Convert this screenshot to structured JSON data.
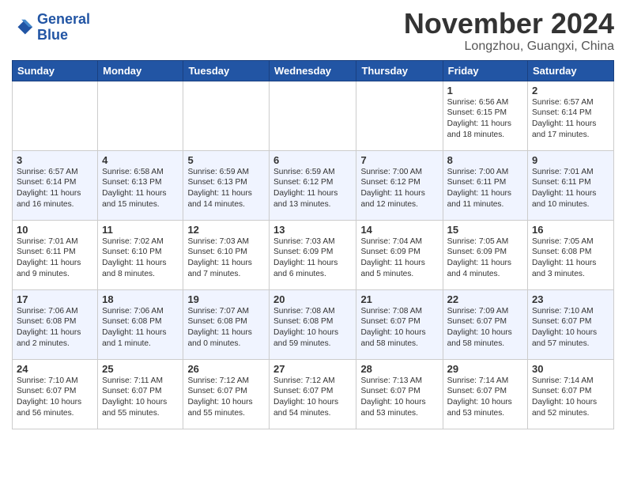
{
  "header": {
    "logo_line1": "General",
    "logo_line2": "Blue",
    "month_title": "November 2024",
    "location": "Longzhou, Guangxi, China"
  },
  "days_of_week": [
    "Sunday",
    "Monday",
    "Tuesday",
    "Wednesday",
    "Thursday",
    "Friday",
    "Saturday"
  ],
  "weeks": [
    [
      {
        "day": "",
        "info": ""
      },
      {
        "day": "",
        "info": ""
      },
      {
        "day": "",
        "info": ""
      },
      {
        "day": "",
        "info": ""
      },
      {
        "day": "",
        "info": ""
      },
      {
        "day": "1",
        "info": "Sunrise: 6:56 AM\nSunset: 6:15 PM\nDaylight: 11 hours and 18 minutes."
      },
      {
        "day": "2",
        "info": "Sunrise: 6:57 AM\nSunset: 6:14 PM\nDaylight: 11 hours and 17 minutes."
      }
    ],
    [
      {
        "day": "3",
        "info": "Sunrise: 6:57 AM\nSunset: 6:14 PM\nDaylight: 11 hours and 16 minutes."
      },
      {
        "day": "4",
        "info": "Sunrise: 6:58 AM\nSunset: 6:13 PM\nDaylight: 11 hours and 15 minutes."
      },
      {
        "day": "5",
        "info": "Sunrise: 6:59 AM\nSunset: 6:13 PM\nDaylight: 11 hours and 14 minutes."
      },
      {
        "day": "6",
        "info": "Sunrise: 6:59 AM\nSunset: 6:12 PM\nDaylight: 11 hours and 13 minutes."
      },
      {
        "day": "7",
        "info": "Sunrise: 7:00 AM\nSunset: 6:12 PM\nDaylight: 11 hours and 12 minutes."
      },
      {
        "day": "8",
        "info": "Sunrise: 7:00 AM\nSunset: 6:11 PM\nDaylight: 11 hours and 11 minutes."
      },
      {
        "day": "9",
        "info": "Sunrise: 7:01 AM\nSunset: 6:11 PM\nDaylight: 11 hours and 10 minutes."
      }
    ],
    [
      {
        "day": "10",
        "info": "Sunrise: 7:01 AM\nSunset: 6:11 PM\nDaylight: 11 hours and 9 minutes."
      },
      {
        "day": "11",
        "info": "Sunrise: 7:02 AM\nSunset: 6:10 PM\nDaylight: 11 hours and 8 minutes."
      },
      {
        "day": "12",
        "info": "Sunrise: 7:03 AM\nSunset: 6:10 PM\nDaylight: 11 hours and 7 minutes."
      },
      {
        "day": "13",
        "info": "Sunrise: 7:03 AM\nSunset: 6:09 PM\nDaylight: 11 hours and 6 minutes."
      },
      {
        "day": "14",
        "info": "Sunrise: 7:04 AM\nSunset: 6:09 PM\nDaylight: 11 hours and 5 minutes."
      },
      {
        "day": "15",
        "info": "Sunrise: 7:05 AM\nSunset: 6:09 PM\nDaylight: 11 hours and 4 minutes."
      },
      {
        "day": "16",
        "info": "Sunrise: 7:05 AM\nSunset: 6:08 PM\nDaylight: 11 hours and 3 minutes."
      }
    ],
    [
      {
        "day": "17",
        "info": "Sunrise: 7:06 AM\nSunset: 6:08 PM\nDaylight: 11 hours and 2 minutes."
      },
      {
        "day": "18",
        "info": "Sunrise: 7:06 AM\nSunset: 6:08 PM\nDaylight: 11 hours and 1 minute."
      },
      {
        "day": "19",
        "info": "Sunrise: 7:07 AM\nSunset: 6:08 PM\nDaylight: 11 hours and 0 minutes."
      },
      {
        "day": "20",
        "info": "Sunrise: 7:08 AM\nSunset: 6:08 PM\nDaylight: 10 hours and 59 minutes."
      },
      {
        "day": "21",
        "info": "Sunrise: 7:08 AM\nSunset: 6:07 PM\nDaylight: 10 hours and 58 minutes."
      },
      {
        "day": "22",
        "info": "Sunrise: 7:09 AM\nSunset: 6:07 PM\nDaylight: 10 hours and 58 minutes."
      },
      {
        "day": "23",
        "info": "Sunrise: 7:10 AM\nSunset: 6:07 PM\nDaylight: 10 hours and 57 minutes."
      }
    ],
    [
      {
        "day": "24",
        "info": "Sunrise: 7:10 AM\nSunset: 6:07 PM\nDaylight: 10 hours and 56 minutes."
      },
      {
        "day": "25",
        "info": "Sunrise: 7:11 AM\nSunset: 6:07 PM\nDaylight: 10 hours and 55 minutes."
      },
      {
        "day": "26",
        "info": "Sunrise: 7:12 AM\nSunset: 6:07 PM\nDaylight: 10 hours and 55 minutes."
      },
      {
        "day": "27",
        "info": "Sunrise: 7:12 AM\nSunset: 6:07 PM\nDaylight: 10 hours and 54 minutes."
      },
      {
        "day": "28",
        "info": "Sunrise: 7:13 AM\nSunset: 6:07 PM\nDaylight: 10 hours and 53 minutes."
      },
      {
        "day": "29",
        "info": "Sunrise: 7:14 AM\nSunset: 6:07 PM\nDaylight: 10 hours and 53 minutes."
      },
      {
        "day": "30",
        "info": "Sunrise: 7:14 AM\nSunset: 6:07 PM\nDaylight: 10 hours and 52 minutes."
      }
    ]
  ]
}
